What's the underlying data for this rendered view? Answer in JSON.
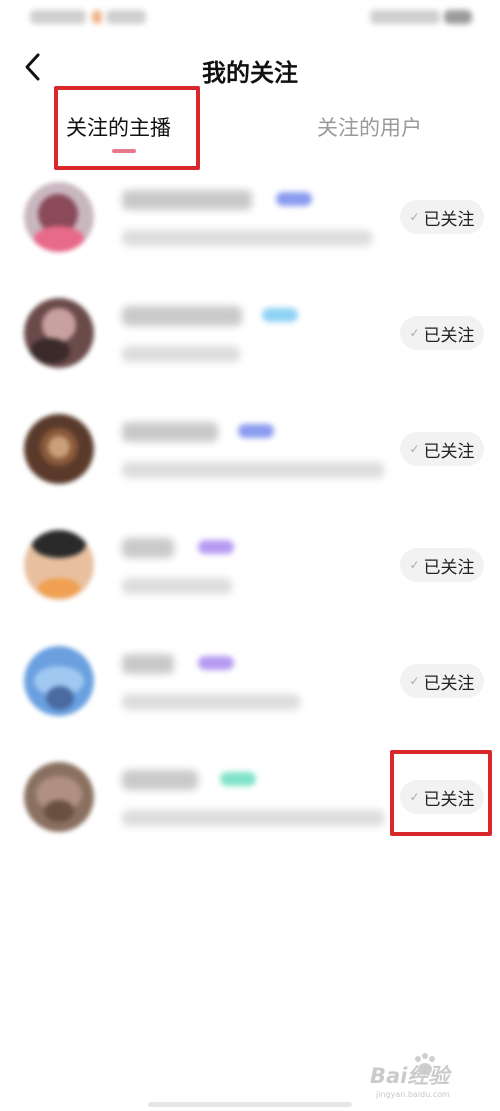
{
  "header": {
    "title": "我的关注"
  },
  "tabs": [
    {
      "label": "关注的主播",
      "active": true
    },
    {
      "label": "关注的用户",
      "active": false
    }
  ],
  "follow_list": [
    {
      "follow_label": "已关注",
      "level_color": "#8a9bf0",
      "avatar_colors": [
        "#c9b7bf",
        "#8a4a5a",
        "#e86a8a"
      ]
    },
    {
      "follow_label": "已关注",
      "level_color": "#8fd3f4",
      "avatar_colors": [
        "#6b4a4a",
        "#c9a0a0",
        "#3a2a2a"
      ]
    },
    {
      "follow_label": "已关注",
      "level_color": "#8a9bf0",
      "avatar_colors": [
        "#5a3a2a",
        "#8a5a3a",
        "#c9a07a"
      ]
    },
    {
      "follow_label": "已关注",
      "level_color": "#b69af2",
      "avatar_colors": [
        "#e8c0a0",
        "#2a2a2a",
        "#f0a050"
      ]
    },
    {
      "follow_label": "已关注",
      "level_color": "#b69af2",
      "avatar_colors": [
        "#6aa0e0",
        "#a0c8f0",
        "#4a6aa0"
      ]
    },
    {
      "follow_label": "已关注",
      "level_color": "#7fe3c8",
      "avatar_colors": [
        "#8a7060",
        "#b09080",
        "#6a5040"
      ]
    }
  ],
  "watermark": {
    "brand": "Bai经验",
    "sub": "jingyan.baidu.com"
  },
  "colors": {
    "highlight_box": "#d8282b",
    "tab_indicator": "#e8788c",
    "inactive_tab": "#9a9a9a",
    "follow_button_bg": "#f2f2f2"
  }
}
